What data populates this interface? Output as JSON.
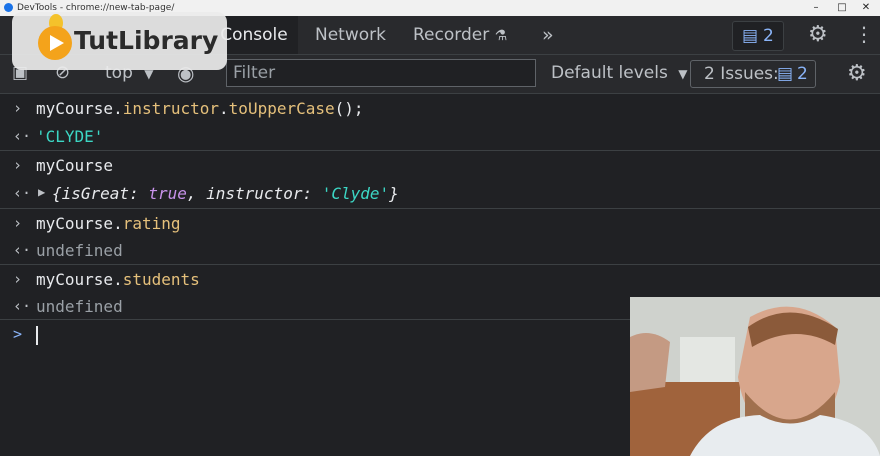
{
  "window": {
    "title": "DevTools - chrome://new-tab-page/"
  },
  "logo": {
    "brand": "TutLibrary"
  },
  "tabs": {
    "console": "Console",
    "network": "Network",
    "recorder": "Recorder",
    "more": "»",
    "messages_count": "2"
  },
  "toolbar": {
    "context": "top",
    "filter_placeholder": "Filter",
    "levels": "Default levels",
    "issues_label": "2 Issues:",
    "issues_count": "2"
  },
  "console": {
    "entries": [
      {
        "input": "myCourse.instructor.toUpperCase();",
        "output": "'CLYDE'"
      },
      {
        "input": "myCourse",
        "output": "{isGreat: true, instructor: 'Clyde'}"
      },
      {
        "input": "myCourse.rating",
        "output": "undefined"
      },
      {
        "input": "myCourse.students",
        "output": "undefined"
      }
    ],
    "input_prompt": ">"
  },
  "colors": {
    "background": "#202124",
    "toolbar": "#292a2d",
    "property": "#e5c07b",
    "string": "#3cd7c5",
    "keyword": "#c792ea",
    "accent": "#8ab4f8"
  }
}
